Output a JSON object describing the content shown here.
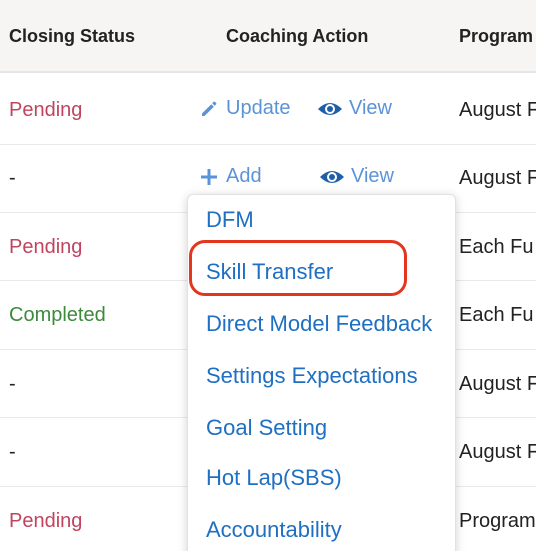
{
  "headers": {
    "closing_status": "Closing Status",
    "coaching_action": "Coaching Action",
    "program": "Program"
  },
  "rows": [
    {
      "status": "Pending",
      "actions": [
        {
          "label": "Update",
          "icon": "pencil-icon"
        },
        {
          "label": "View",
          "icon": "eye-icon"
        }
      ],
      "program": "August F"
    },
    {
      "status": "-",
      "actions": [
        {
          "label": "Add",
          "icon": "plus-icon"
        },
        {
          "label": "View",
          "icon": "eye-icon"
        }
      ],
      "program": "August F"
    },
    {
      "status": "Pending",
      "program": "Each Fu"
    },
    {
      "status": "Completed",
      "program": "Each Fu"
    },
    {
      "status": "-",
      "program": "August F"
    },
    {
      "status": "-",
      "program": "August F"
    },
    {
      "status": "Pending",
      "program": "Program"
    }
  ],
  "dropdown": {
    "items": [
      "DFM",
      "Skill Transfer",
      "Direct Model Feedback",
      "Settings Expectations",
      "Goal Setting",
      "Hot Lap(SBS)",
      "Accountability"
    ],
    "highlighted_item": "Skill Transfer"
  },
  "colors": {
    "pending": "#c0445e",
    "completed": "#3c8a3c",
    "action_link": "#5b93d8",
    "menu_link": "#1f6fc2",
    "highlight_ring": "#e4361f",
    "header_bg": "#f6f5f4"
  }
}
